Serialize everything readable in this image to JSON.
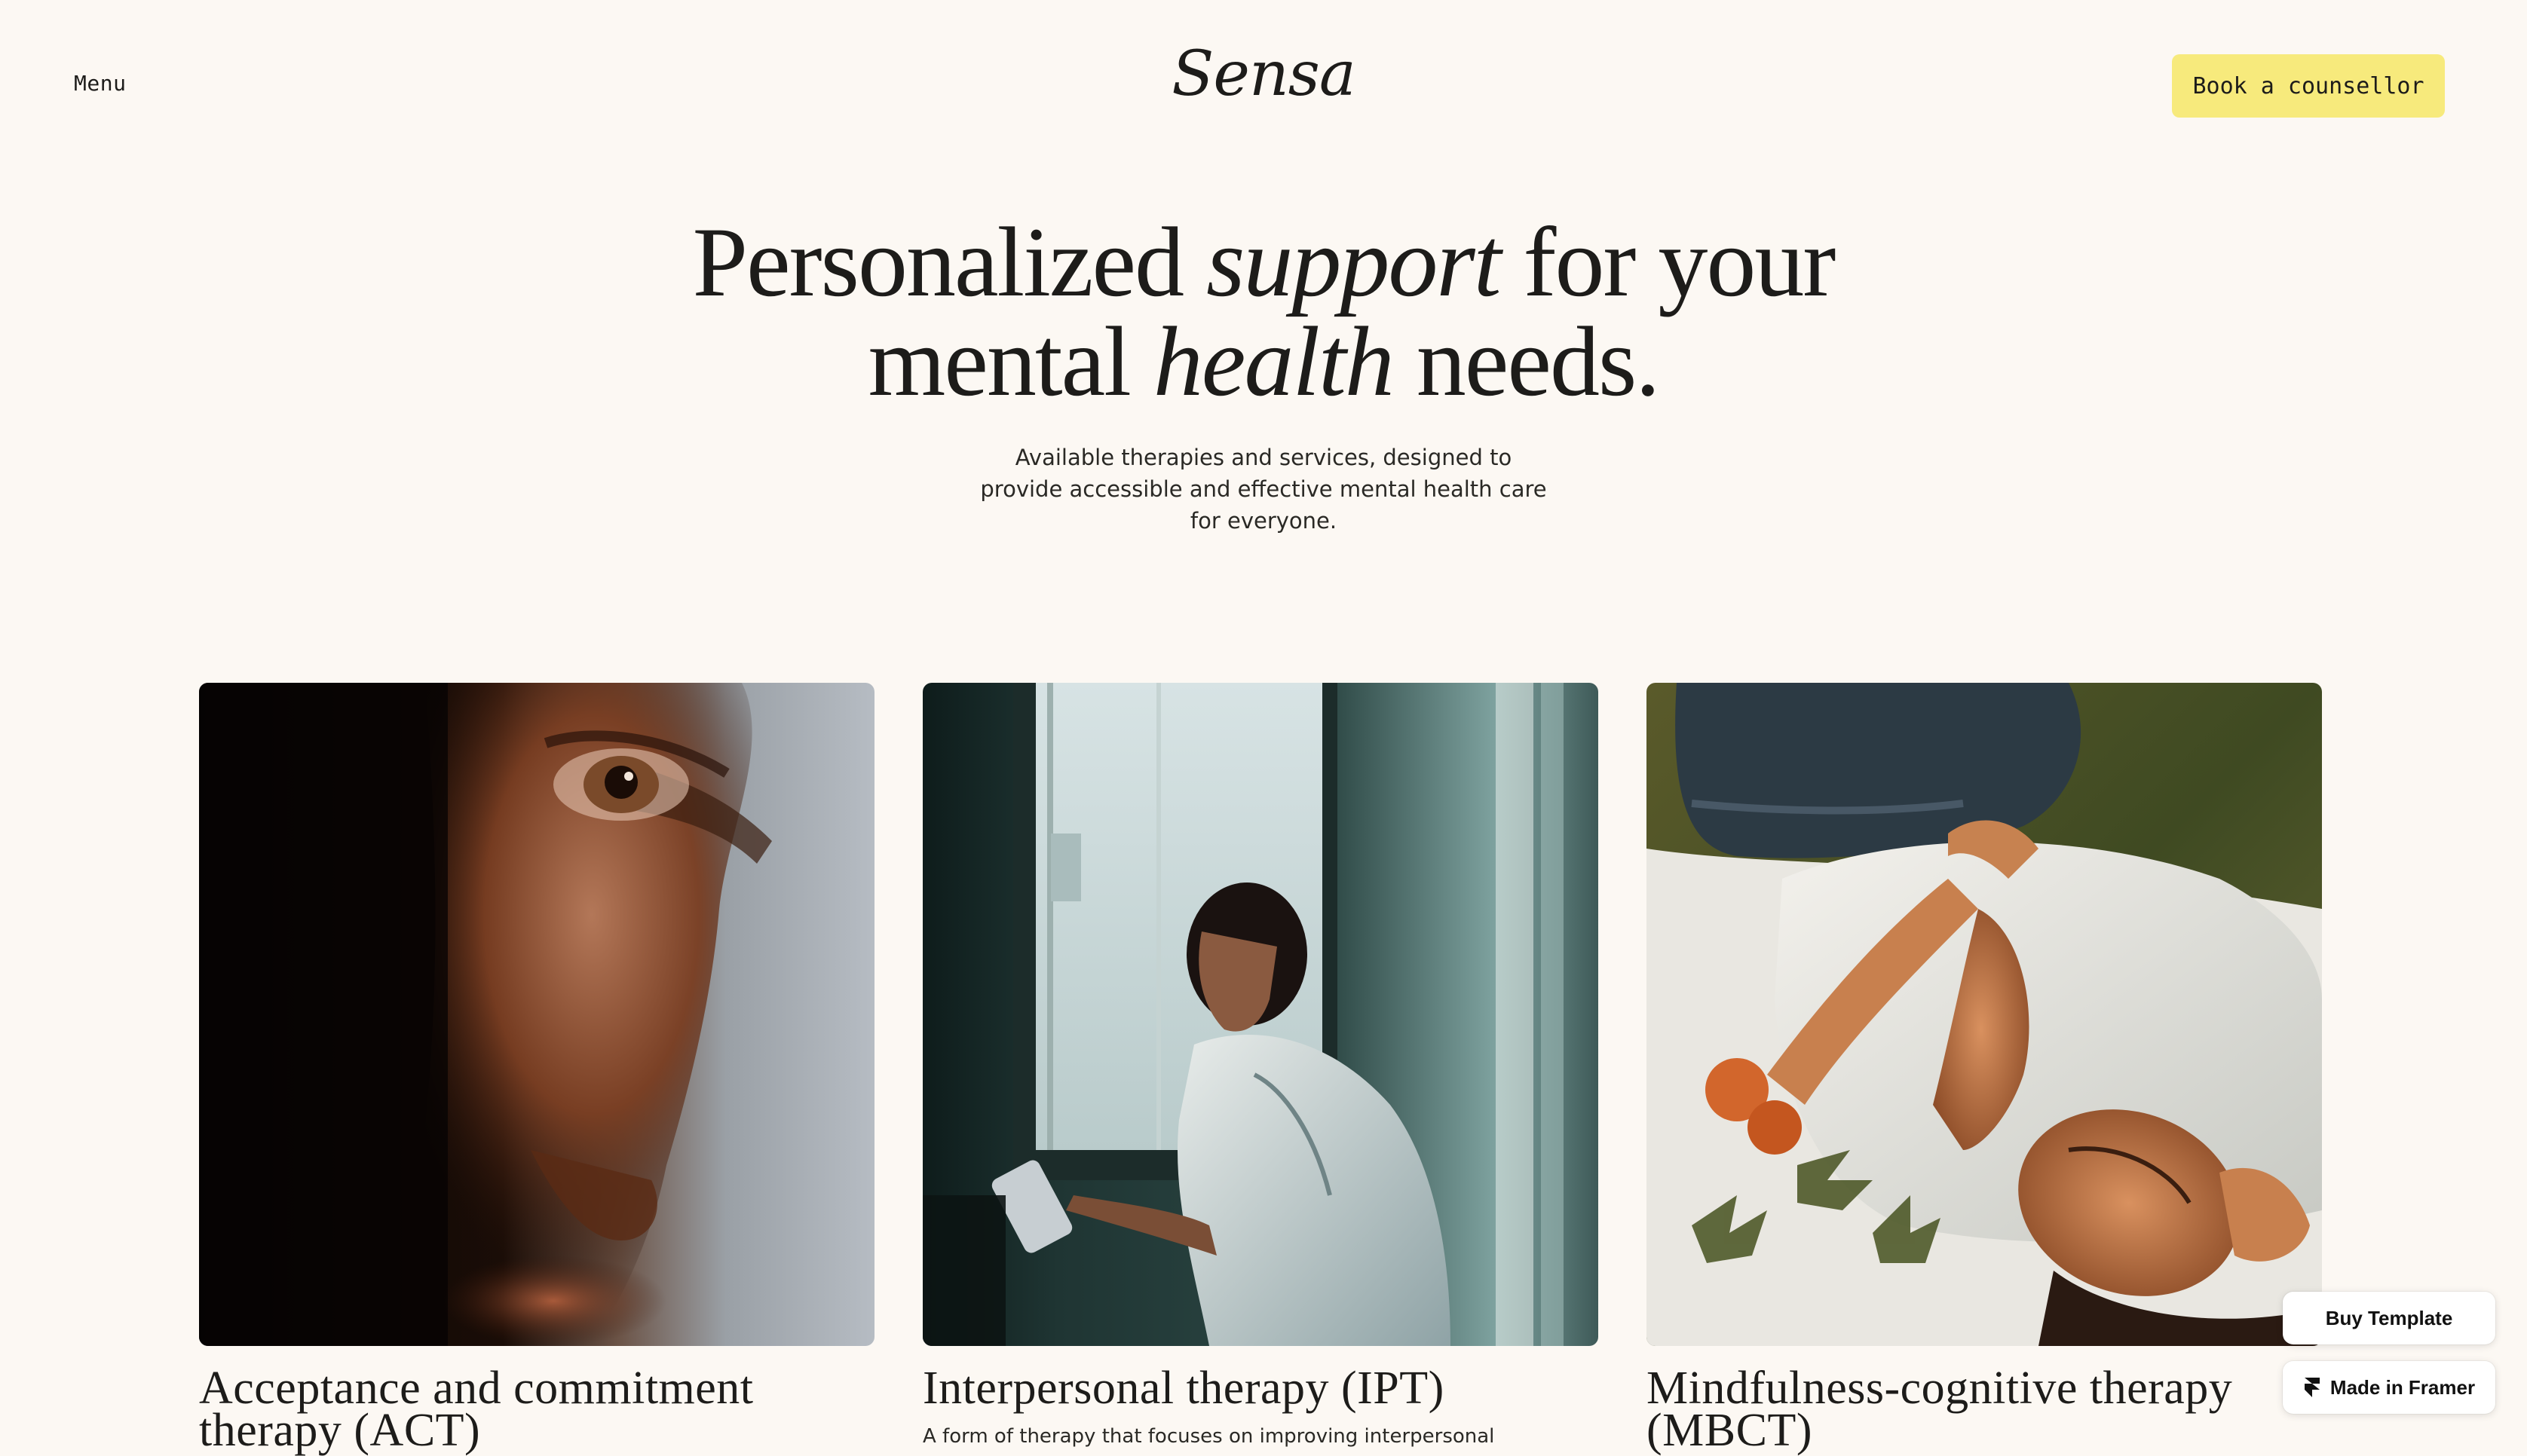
{
  "header": {
    "menu_label": "Menu",
    "logo": "Sensa",
    "cta_label": "Book a counsellor"
  },
  "hero": {
    "title_line1_a": "Personalized ",
    "title_line1_em": "support",
    "title_line1_b": " for your",
    "title_line2_a": "mental ",
    "title_line2_em": "health",
    "title_line2_b": " needs.",
    "subtitle": "Available therapies and services, designed to provide accessible and effective mental health care for everyone."
  },
  "cards": [
    {
      "title": "Acceptance and commitment therapy (ACT)",
      "description": "",
      "image": "portrait-closeup-eye"
    },
    {
      "title": "Interpersonal therapy (IPT)",
      "description": "A form of therapy that focuses on improving interpersonal",
      "image": "man-with-phone-by-window"
    },
    {
      "title": "Mindfulness-cognitive therapy (MBCT)",
      "description": "",
      "image": "woman-lying-on-grass"
    }
  ],
  "badges": {
    "buy_template": "Buy Template",
    "made_in_framer": "Made in Framer"
  },
  "colors": {
    "background": "#fcf8f3",
    "accent": "#f7ea7c",
    "text": "#1d1c1a"
  }
}
